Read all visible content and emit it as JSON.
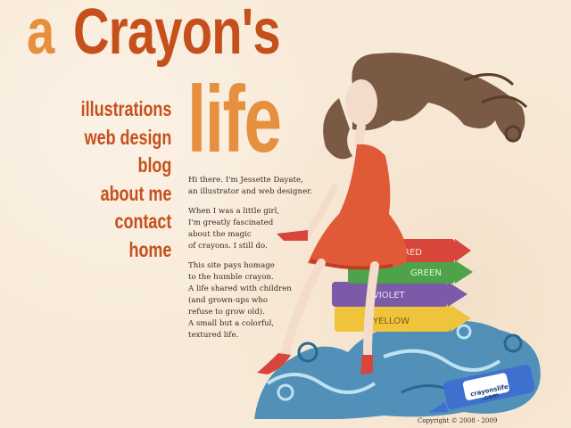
{
  "logo": {
    "word_a": "a",
    "word_crayons": "Crayon's",
    "word_life": "life",
    "colors": {
      "light": "#e58f3f",
      "dark": "#c5501c"
    }
  },
  "nav": {
    "items": [
      {
        "label": "illustrations"
      },
      {
        "label": "web design"
      },
      {
        "label": "blog"
      },
      {
        "label": "about me"
      },
      {
        "label": "contact"
      },
      {
        "label": "home"
      }
    ]
  },
  "intro": {
    "paragraphs": [
      "Hi there. I'm Jessette Dayate,\nan illustrator and web designer.",
      "When I was a little girl,\nI'm greatly fascinated\nabout the magic\nof crayons. I still do.",
      "This site pays homage\nto the humble crayon.\nA life shared with children\n(and grown-ups who\nrefuse to grow old).\nA small but a colorful,\ntextured life."
    ]
  },
  "illustration": {
    "crayons": [
      {
        "label": "RED",
        "color": "#d8453a"
      },
      {
        "label": "GREEN",
        "color": "#4ea34a"
      },
      {
        "label": "VIOLET",
        "color": "#7b5ba8"
      },
      {
        "label": "YELLOW",
        "color": "#f0c43a"
      }
    ],
    "blue_crayon_label": "crayonslife\n.com"
  },
  "footer": {
    "copyright": "Copyright © 2008 - 2009"
  }
}
